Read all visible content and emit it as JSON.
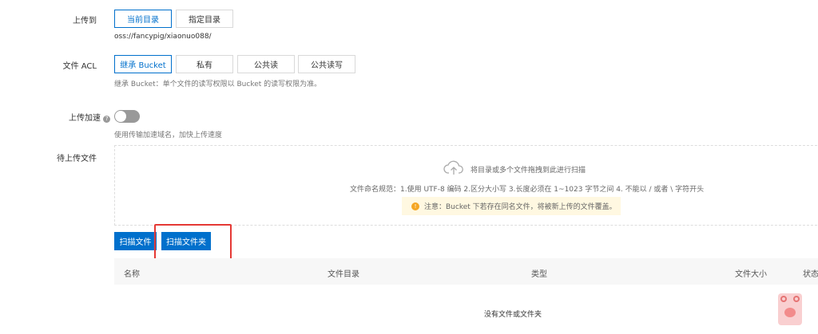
{
  "upload_to": {
    "label": "上传到",
    "options": [
      "当前目录",
      "指定目录"
    ],
    "path": "oss://fancypig/xiaonuo088/"
  },
  "acl": {
    "label": "文件 ACL",
    "options": [
      "继承 Bucket",
      "私有",
      "公共读",
      "公共读写"
    ],
    "hint": "继承 Bucket：单个文件的读写权限以 Bucket 的读写权限为准。"
  },
  "accel": {
    "label": "上传加速",
    "enabled": false,
    "hint": "使用传输加速域名，加快上传速度"
  },
  "pending": {
    "label": "待上传文件",
    "drop_text": "将目录或多个文件拖拽到此进行扫描",
    "naming_rule": "文件命名规范：1.使用 UTF-8 编码 2.区分大小写 3.长度必须在 1~1023 字节之间 4. 不能以 / 或者 \\ 字符开头",
    "warning": "注意：Bucket 下若存在同名文件，将被新上传的文件覆盖。"
  },
  "buttons": {
    "scan_files": "扫描文件",
    "scan_folder": "扫描文件夹"
  },
  "table": {
    "columns": [
      "名称",
      "文件目录",
      "类型",
      "文件大小",
      "状态"
    ],
    "empty": "没有文件或文件夹"
  },
  "colors": {
    "primary": "#0070cc",
    "highlight": "#e53935",
    "warning_bg": "#fff8e1"
  }
}
